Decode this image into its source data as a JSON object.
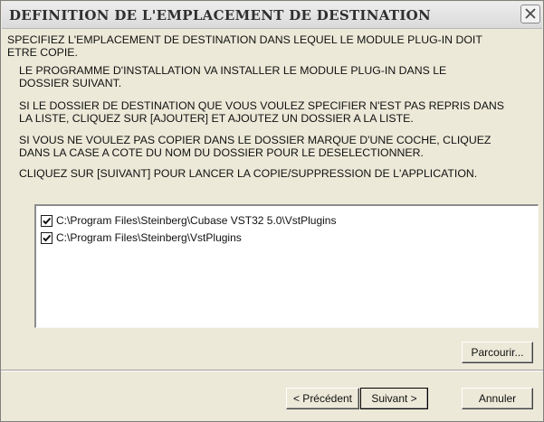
{
  "window": {
    "title": "DEFINITION DE L'EMPLACEMENT DE DESTINATION",
    "close_icon": "close-icon"
  },
  "instructions": {
    "p1": "SPECIFIEZ L'EMPLACEMENT DE DESTINATION DANS LEQUEL LE MODULE PLUG-IN DOIT\nETRE COPIE.",
    "p2": "LE PROGRAMME D'INSTALLATION VA INSTALLER LE MODULE PLUG-IN DANS LE\nDOSSIER SUIVANT.",
    "p3": "SI LE DOSSIER DE DESTINATION QUE VOUS VOULEZ SPECIFIER N'EST PAS REPRIS DANS\nLA LISTE, CLIQUEZ SUR [AJOUTER] ET AJOUTEZ UN DOSSIER A LA LISTE.",
    "p4": "SI VOUS NE VOULEZ PAS COPIER DANS LE DOSSIER MARQUE D'UNE COCHE, CLIQUEZ\nDANS LA CASE A COTE DU NOM DU DOSSIER POUR LE DESELECTIONNER.",
    "p5": "CLIQUEZ SUR [SUIVANT] POUR LANCER LA COPIE/SUPPRESSION DE L'APPLICATION."
  },
  "folders": [
    {
      "path": "C:\\Program Files\\Steinberg\\Cubase VST32 5.0\\VstPlugins",
      "checked": true
    },
    {
      "path": "C:\\Program Files\\Steinberg\\VstPlugins",
      "checked": true
    }
  ],
  "buttons": {
    "browse": "Parcourir...",
    "back": "< Précédent",
    "next": "Suivant >",
    "cancel": "Annuler"
  }
}
